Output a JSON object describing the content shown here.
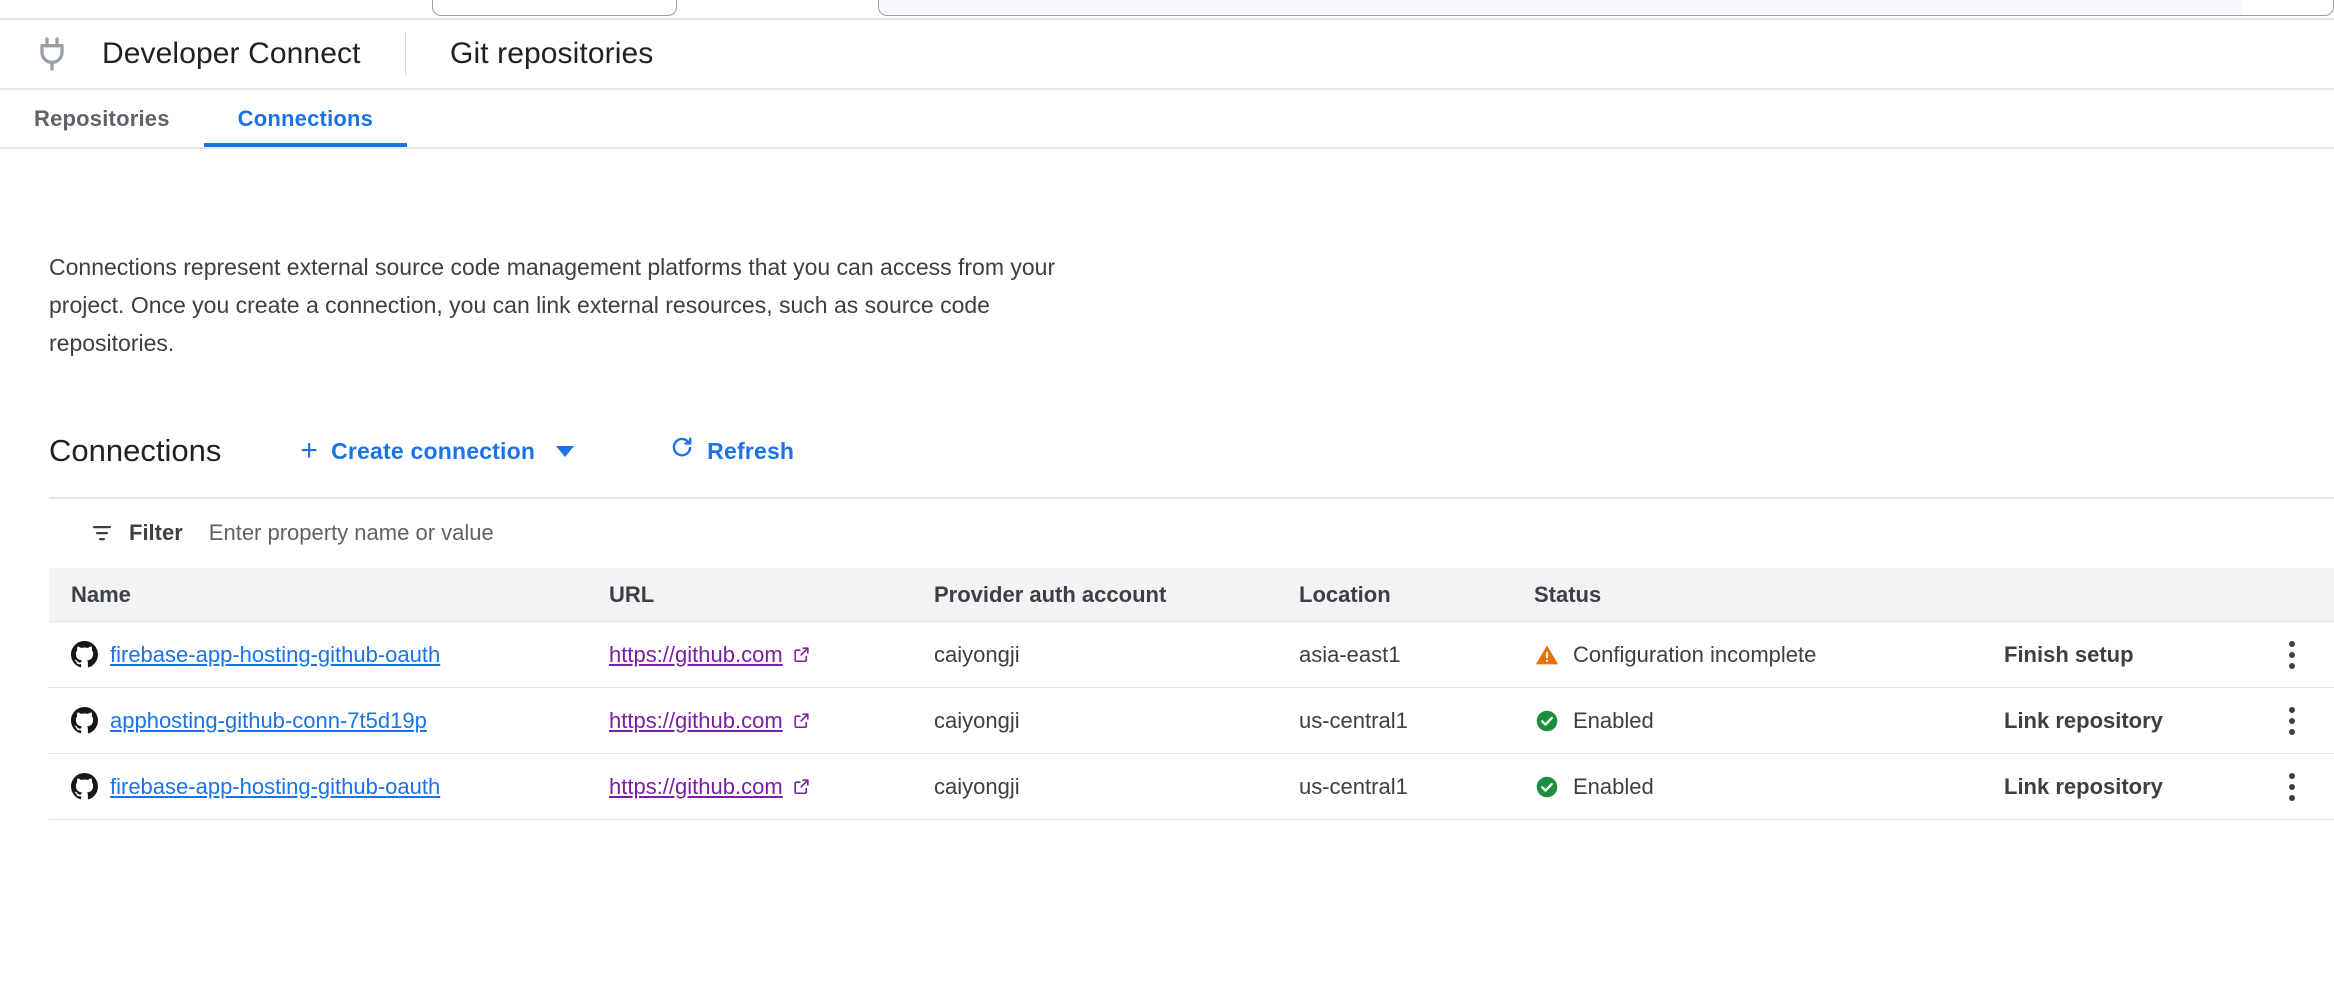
{
  "window_chrome": {
    "tab_strip_visible": true,
    "omnibox_visible": true
  },
  "header": {
    "product_icon": "plug-icon",
    "product_title": "Developer Connect",
    "page_subtitle": "Git repositories"
  },
  "tabs": [
    {
      "label": "Repositories",
      "active": false
    },
    {
      "label": "Connections",
      "active": true
    }
  ],
  "description": "Connections represent external source code management platforms that you can access from your project. Once you create a connection, you can link external resources, such as source code repositories.",
  "section": {
    "title": "Connections",
    "create_label": "Create connection",
    "create_icon": "plus-icon",
    "create_caret": "chevron-down-icon",
    "refresh_label": "Refresh",
    "refresh_icon": "refresh-icon"
  },
  "filter": {
    "icon": "filter-icon",
    "label": "Filter",
    "placeholder": "Enter property name or value",
    "value": ""
  },
  "table": {
    "columns": [
      "Name",
      "URL",
      "Provider auth account",
      "Location",
      "Status"
    ],
    "rows": [
      {
        "icon": "github-icon",
        "name": "firebase-app-hosting-github-oauth",
        "url": "https://github.com",
        "url_icon": "external-link-icon",
        "provider_auth_account": "caiyongji",
        "location": "asia-east1",
        "status": "Configuration incomplete",
        "status_icon": "warning-icon",
        "status_color": "#e8710a",
        "action": "Finish setup",
        "menu_icon": "more-vert-icon"
      },
      {
        "icon": "github-icon",
        "name": "apphosting-github-conn-7t5d19p",
        "url": "https://github.com",
        "url_icon": "external-link-icon",
        "provider_auth_account": "caiyongji",
        "location": "us-central1",
        "status": "Enabled",
        "status_icon": "check-circle-icon",
        "status_color": "#1e8e3e",
        "action": "Link repository",
        "menu_icon": "more-vert-icon"
      },
      {
        "icon": "github-icon",
        "name": "firebase-app-hosting-github-oauth",
        "url": "https://github.com",
        "url_icon": "external-link-icon",
        "provider_auth_account": "caiyongji",
        "location": "us-central1",
        "status": "Enabled",
        "status_icon": "check-circle-icon",
        "status_color": "#1e8e3e",
        "action": "Link repository",
        "menu_icon": "more-vert-icon"
      }
    ]
  },
  "colors": {
    "accent_blue": "#1a73e8",
    "link_visited_purple": "#7b1fa2",
    "warning_orange": "#e8710a",
    "success_green": "#1e8e3e",
    "header_row_bg": "#f1f3f4",
    "border": "#e3e5e8"
  }
}
